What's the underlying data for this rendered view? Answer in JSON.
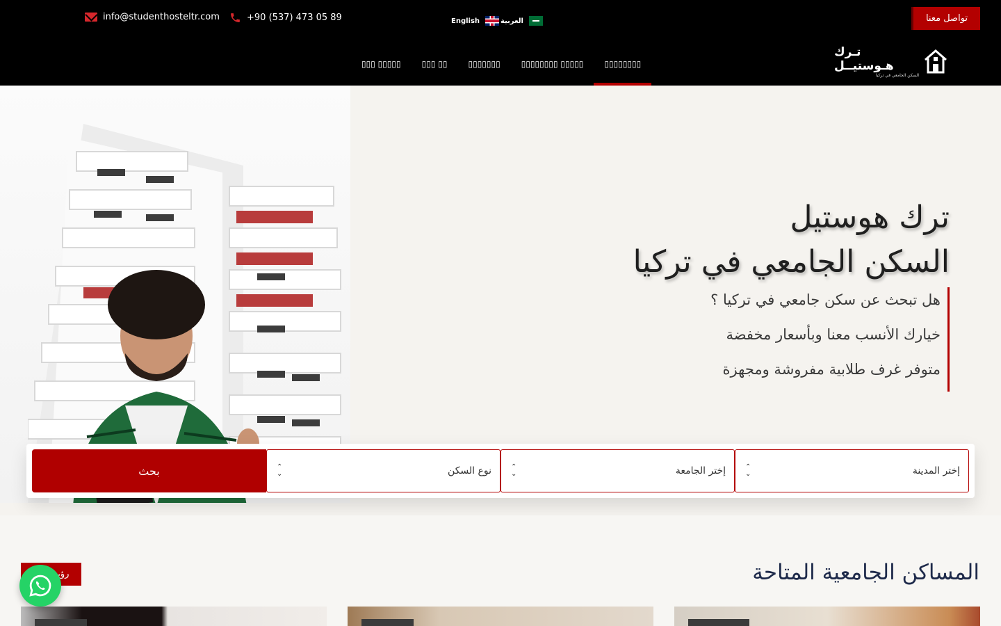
{
  "header": {
    "contact_button": "تواصل معنا",
    "languages": {
      "arabic": "العربية",
      "english": "English"
    },
    "email": "info@studenthosteltr.com",
    "phone": "+90 (537) 473 05 89",
    "nav": [
      "▯▯▯▯▯▯▯▯",
      "▯▯▯▯▯▯▯▯ ▯▯▯▯▯",
      "▯▯▯▯▯▯▯",
      "▯▯▯ ▯▯",
      "▯▯▯ ▯▯▯▯▯"
    ],
    "logo": {
      "main": "تـرك هـوستيــل",
      "sub": "السكن الجامعي في تركيا"
    }
  },
  "hero": {
    "title_line1": "ترك هوستيل",
    "title_line2": "السكن الجامعي في تركيا",
    "bullets": [
      "هل تبحث عن سكن جامعي في تركيا ؟",
      "خيارك الأنسب معنا وبأسعار مخفضة",
      "متوفر غرف طلابية مفروشة ومجهزة"
    ]
  },
  "search": {
    "city_placeholder": "إختر المدينة",
    "university_placeholder": "إختر الجامعة",
    "type_placeholder": "نوع السكن",
    "button": "بحث"
  },
  "section": {
    "title": "المساكن الجامعية المتاحة",
    "more_button": "رؤية الكل"
  },
  "colors": {
    "brand_red": "#b30000",
    "header_bg": "#000000",
    "whatsapp_green": "#25d366",
    "title_navy": "#1e2a4a"
  },
  "icons": [
    "mail-icon",
    "phone-icon",
    "uk-flag-icon",
    "saudi-flag-icon",
    "chevron-updown-icon",
    "whatsapp-icon",
    "logo-house-icon"
  ]
}
